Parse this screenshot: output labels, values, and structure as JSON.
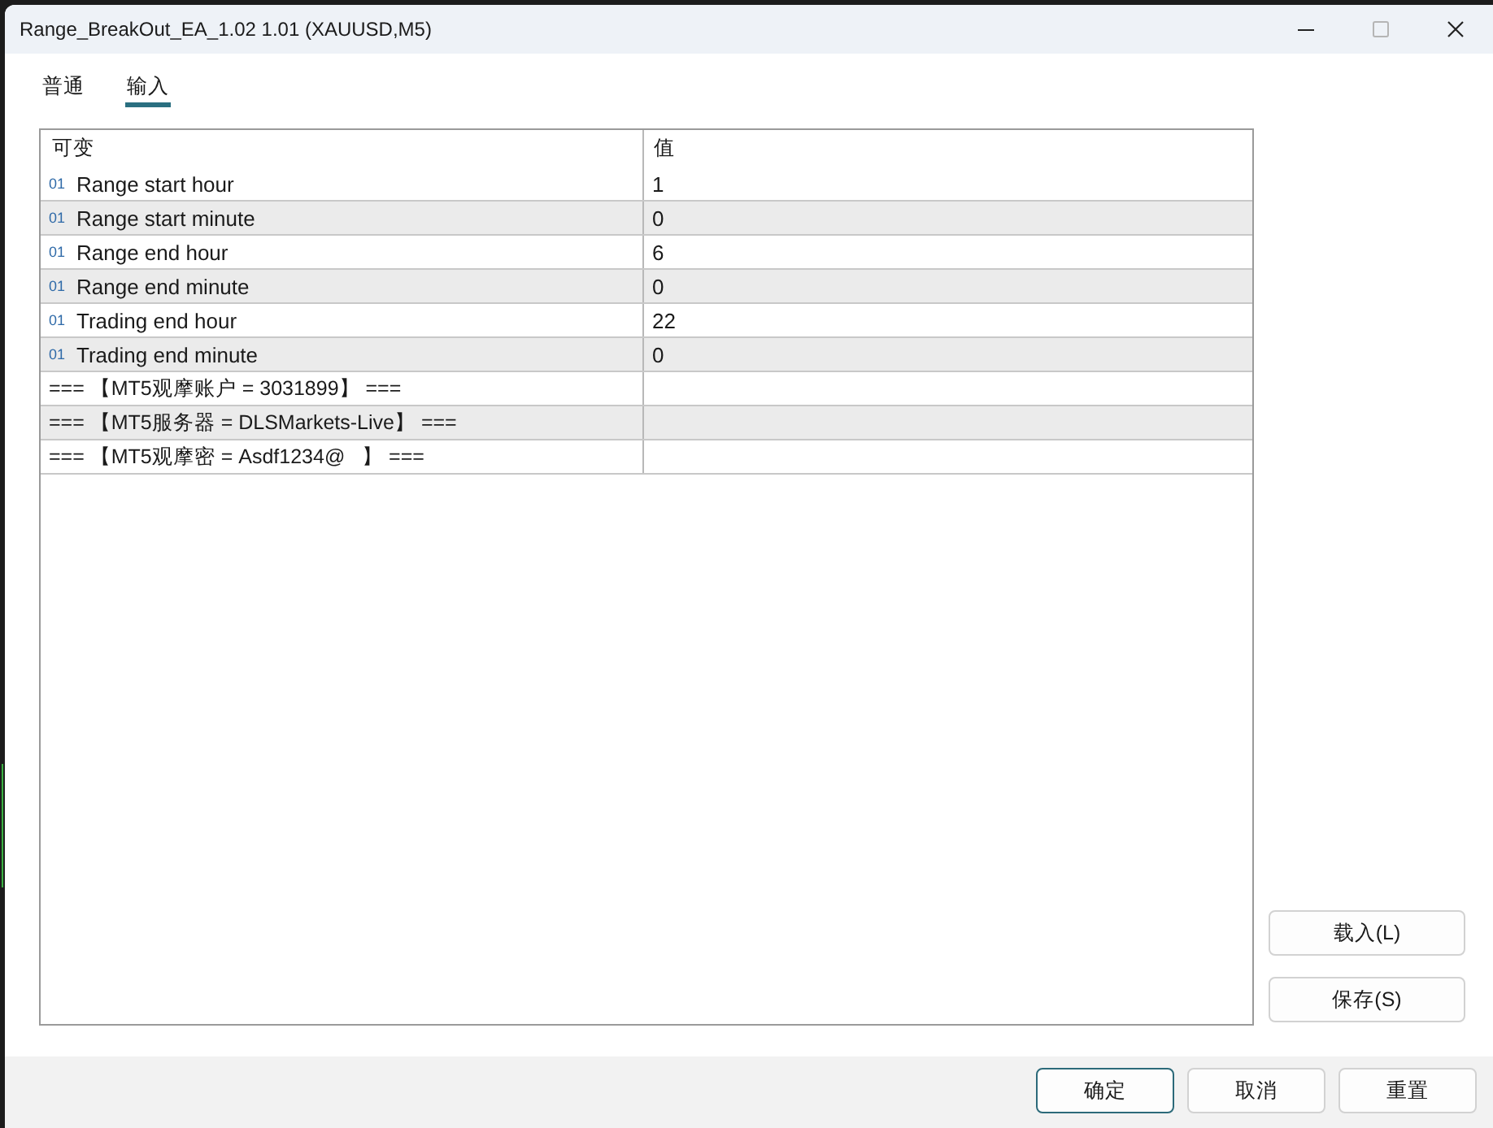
{
  "window": {
    "title": "Range_BreakOut_EA_1.02 1.01 (XAUUSD,M5)",
    "maximize_disabled": true
  },
  "tabs": [
    {
      "label": "普通",
      "selected": false
    },
    {
      "label": "输入",
      "selected": true
    }
  ],
  "table": {
    "columns": [
      "可变",
      "值"
    ],
    "rows": [
      {
        "kind": "int",
        "type_icon": "01",
        "name": "Range start hour",
        "value": "1"
      },
      {
        "kind": "int",
        "type_icon": "01",
        "name": "Range start minute",
        "value": "0"
      },
      {
        "kind": "int",
        "type_icon": "01",
        "name": "Range end hour",
        "value": "6"
      },
      {
        "kind": "int",
        "type_icon": "01",
        "name": "Range end minute",
        "value": "0"
      },
      {
        "kind": "int",
        "type_icon": "01",
        "name": "Trading end hour",
        "value": "22"
      },
      {
        "kind": "int",
        "type_icon": "01",
        "name": "Trading end minute",
        "value": "0"
      },
      {
        "kind": "group",
        "name": "=== 【MT5观摩账户 = 3031899】 ==="
      },
      {
        "kind": "group",
        "name": "=== 【MT5服务器 = DLSMarkets-Live】 ==="
      },
      {
        "kind": "group",
        "name": "=== 【MT5观摩密 = Asdf1234@   】 ==="
      }
    ]
  },
  "side_buttons": [
    "载入(L)",
    "保存(S)"
  ],
  "footer_buttons": [
    {
      "label": "确定",
      "focused": true
    },
    {
      "label": "取消",
      "focused": false
    },
    {
      "label": "重置",
      "focused": false
    }
  ]
}
